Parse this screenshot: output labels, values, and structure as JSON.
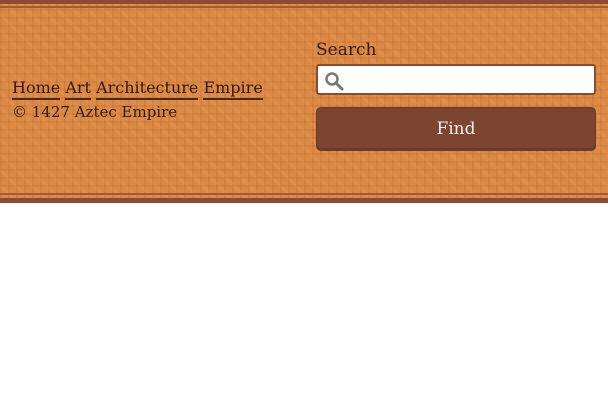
{
  "nav": {
    "links": [
      "Home",
      "Art",
      "Architecture",
      "Empire"
    ]
  },
  "footer": {
    "copyright": "© 1427 Aztec Empire"
  },
  "search": {
    "label": "Search",
    "value": "",
    "placeholder": "",
    "button_label": "Find"
  },
  "theme": {
    "banner_color": "#dd8a45",
    "border_color": "#8a4a34",
    "button_color": "#7c4532"
  },
  "icons": {
    "search": "search-icon"
  }
}
